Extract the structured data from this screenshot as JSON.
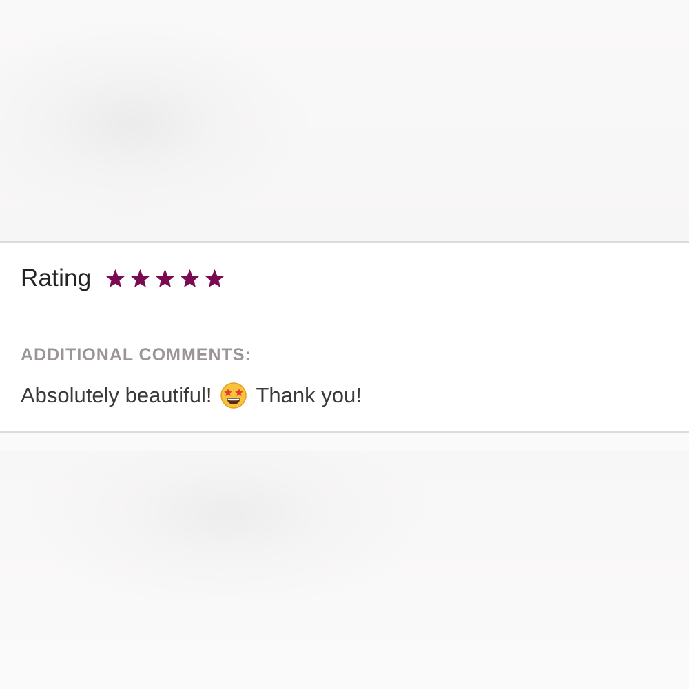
{
  "review": {
    "rating_label": "Rating",
    "rating_value": 5,
    "rating_max": 5,
    "star_color": "#7a0a52",
    "comments_heading": "ADDITIONAL COMMENTS:",
    "comment_part1": "Absolutely beautiful!",
    "comment_emoji": "star-struck-emoji",
    "comment_part2": "Thank you!"
  }
}
